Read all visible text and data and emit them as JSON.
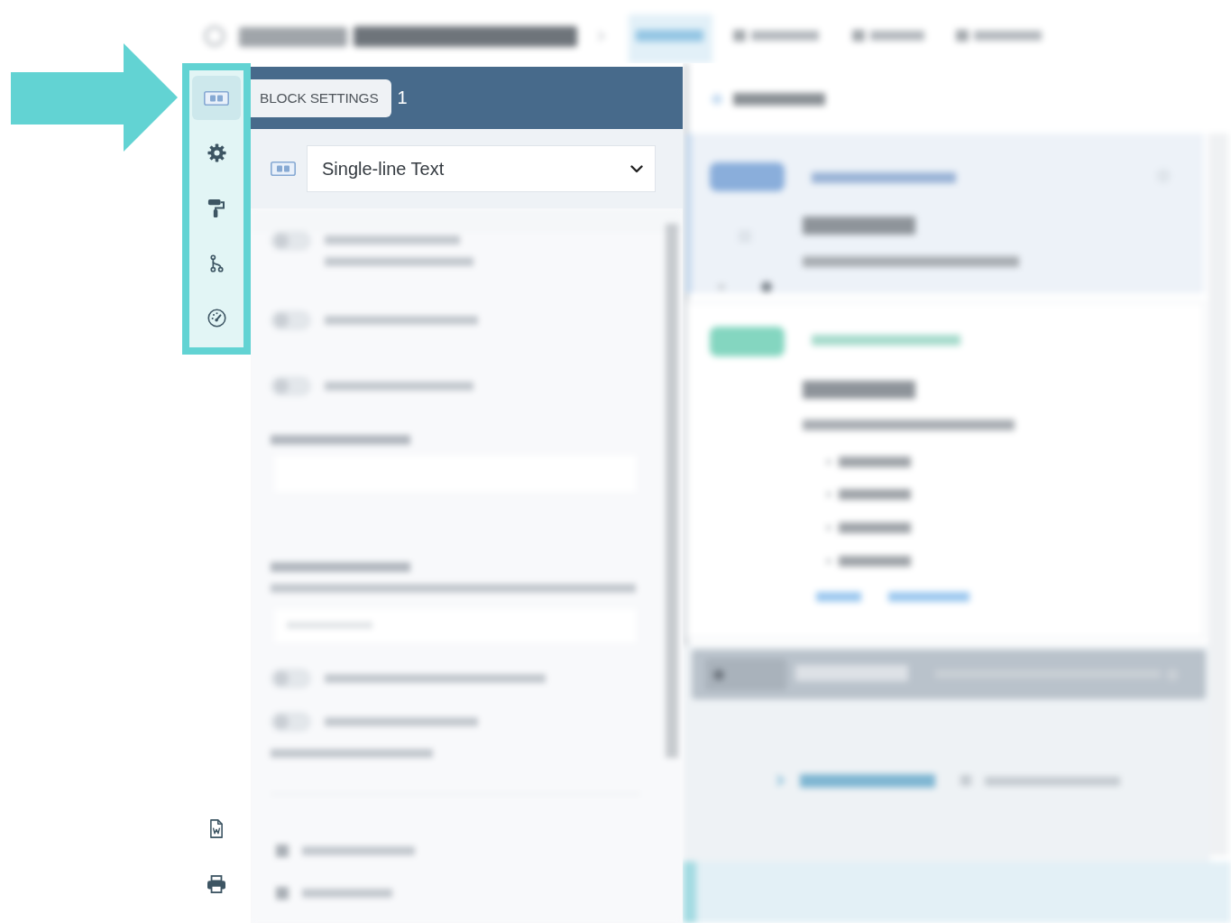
{
  "tool_rail": {
    "highlighted": true,
    "items": [
      {
        "kind": "block",
        "selected": true
      },
      {
        "kind": "settings",
        "selected": false
      },
      {
        "kind": "style",
        "selected": false
      },
      {
        "kind": "logic",
        "selected": false
      },
      {
        "kind": "dashboard",
        "selected": false
      }
    ],
    "bottom_items": [
      {
        "kind": "export"
      },
      {
        "kind": "print"
      }
    ]
  },
  "block_settings": {
    "label": "BLOCK SETTINGS",
    "step": "1",
    "block_type": {
      "value": "Single-line Text"
    }
  }
}
